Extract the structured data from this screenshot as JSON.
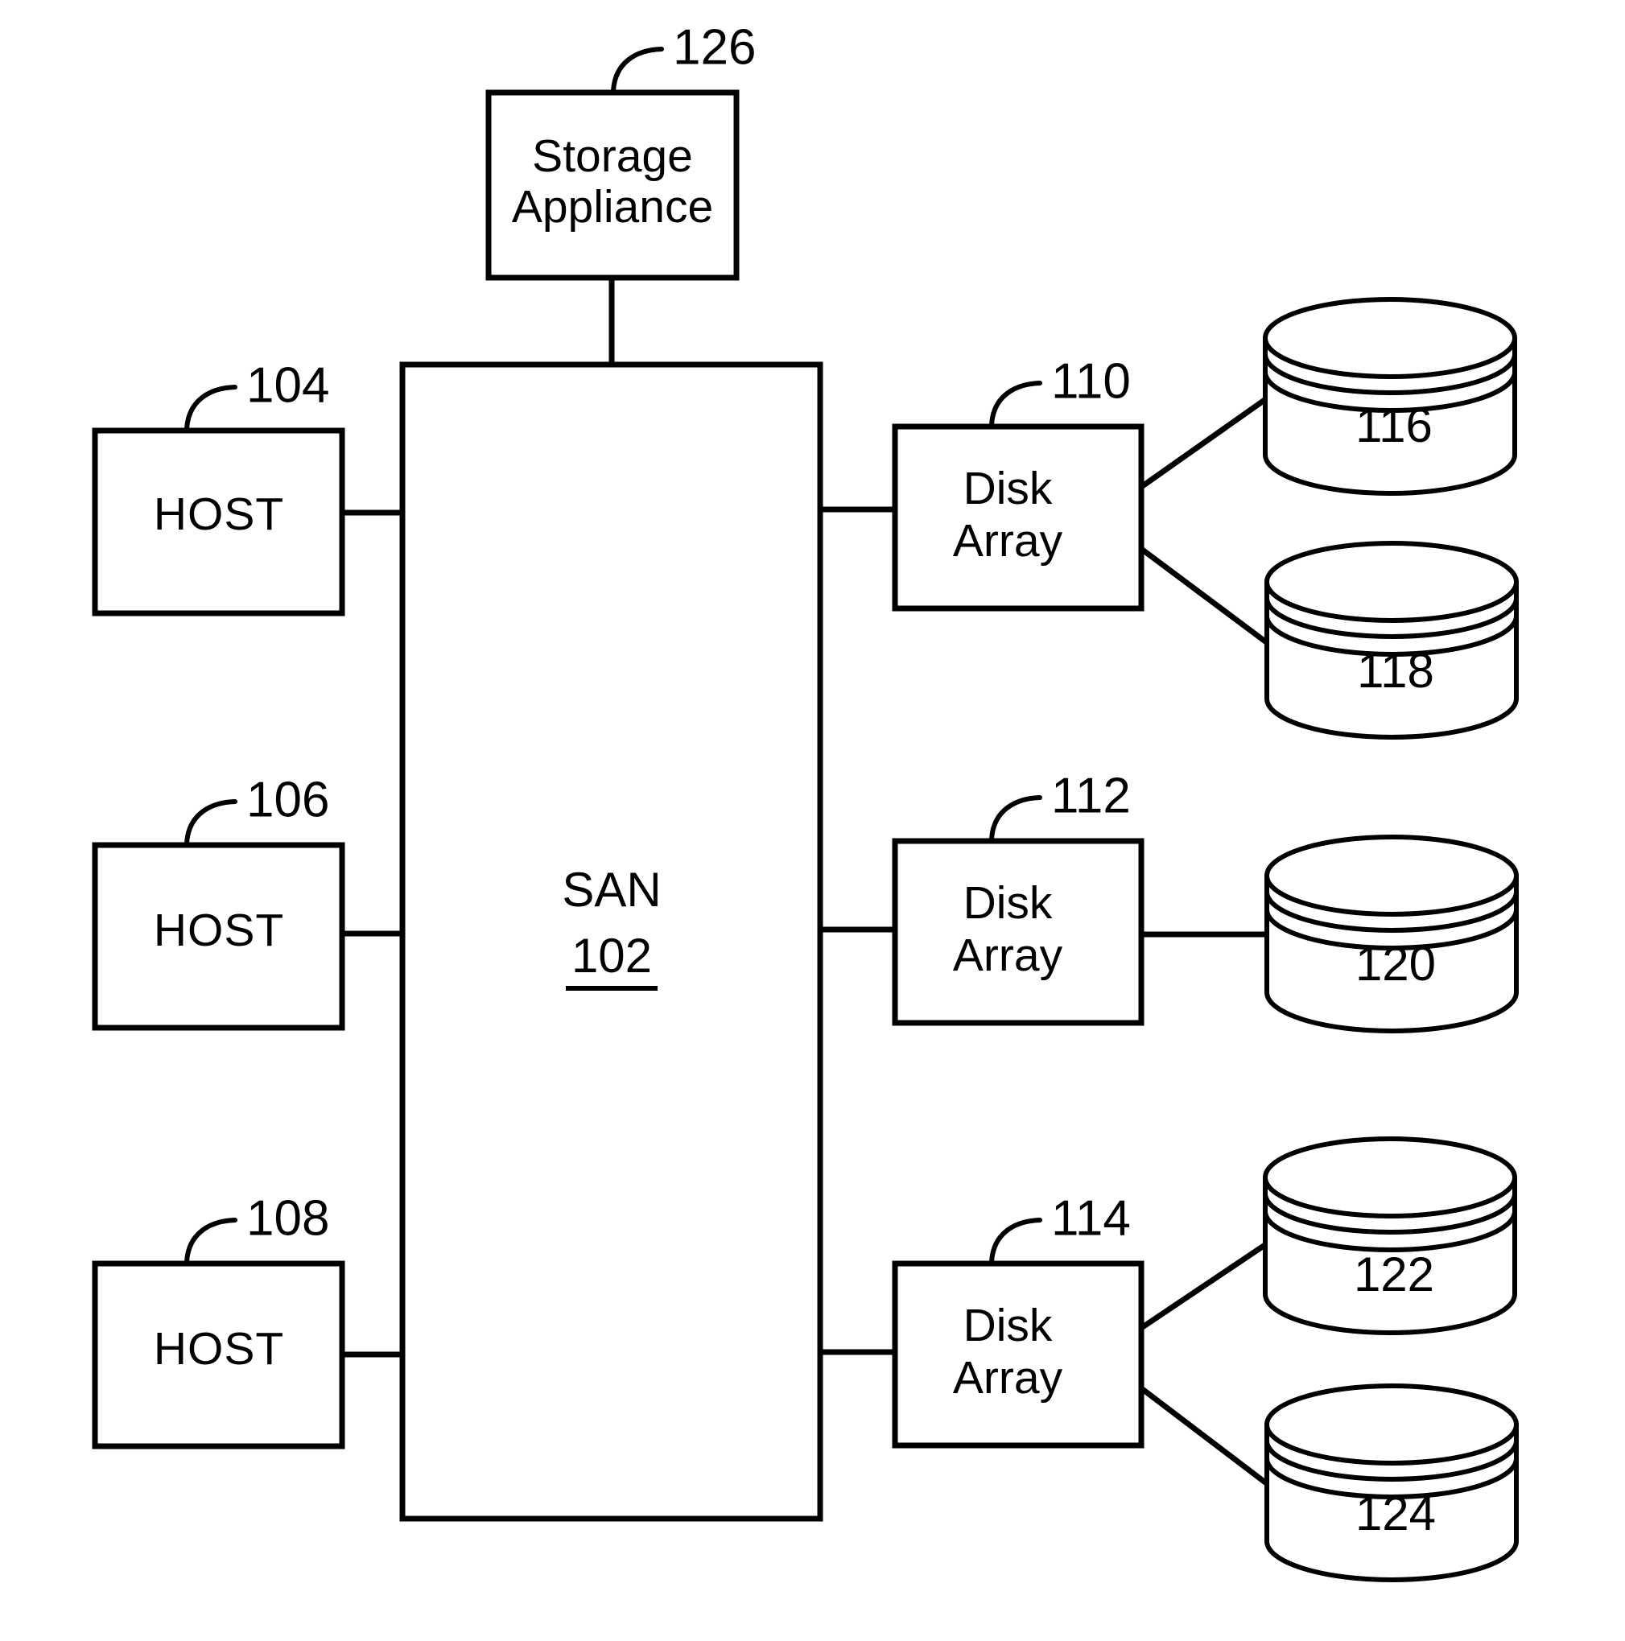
{
  "figure": {
    "type": "patent-block-diagram",
    "title": "Storage Area Network block diagram",
    "background_color": "#ffffff",
    "line_color": "#000000"
  },
  "nodes": {
    "storage_appliance": {
      "label_line1": "Storage",
      "label_line2": "Appliance",
      "callout": "126"
    },
    "san": {
      "label": "SAN",
      "reference_number": "102"
    },
    "hosts": [
      {
        "label": "HOST",
        "callout": "104"
      },
      {
        "label": "HOST",
        "callout": "106"
      },
      {
        "label": "HOST",
        "callout": "108"
      }
    ],
    "disk_arrays": [
      {
        "label_line1": "Disk",
        "label_line2": "Array",
        "callout": "110"
      },
      {
        "label_line1": "Disk",
        "label_line2": "Array",
        "callout": "112"
      },
      {
        "label_line1": "Disk",
        "label_line2": "Array",
        "callout": "114"
      }
    ],
    "disks": [
      {
        "label": "116"
      },
      {
        "label": "118"
      },
      {
        "label": "120"
      },
      {
        "label": "122"
      },
      {
        "label": "124"
      }
    ]
  }
}
